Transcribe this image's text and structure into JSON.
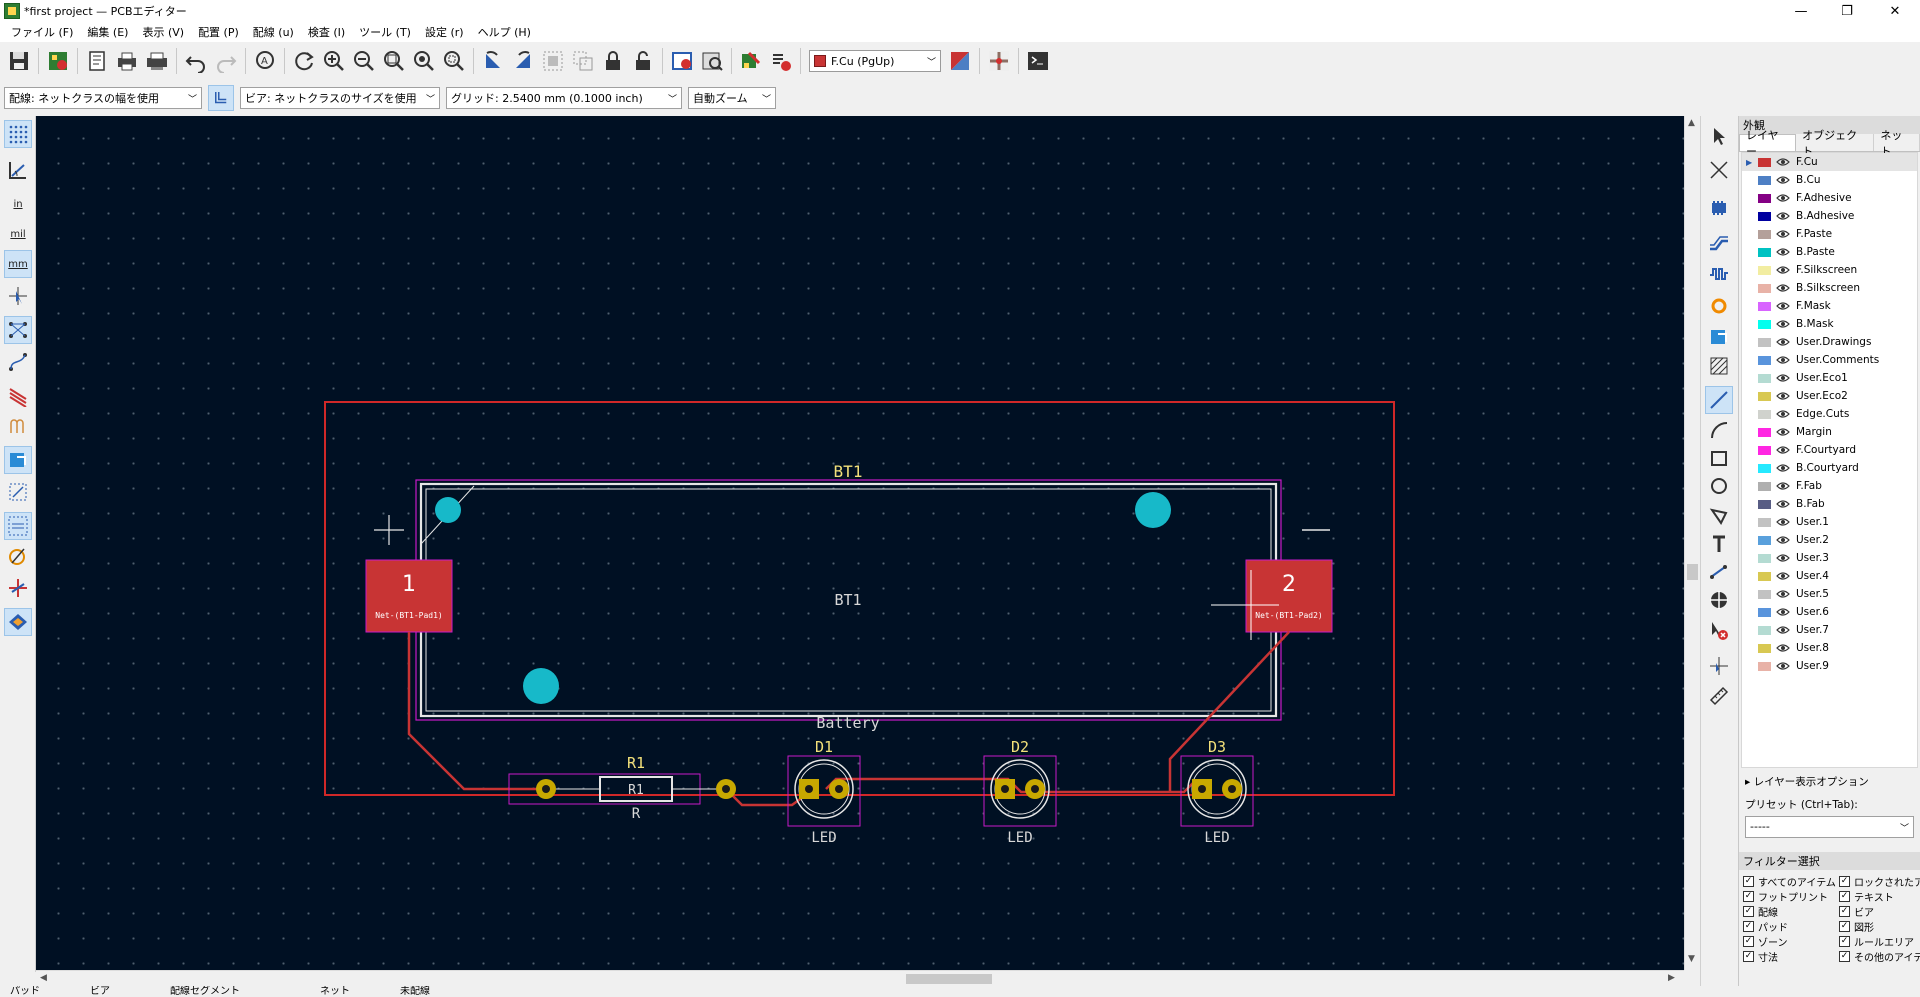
{
  "window": {
    "title": "*first project — PCBエディター",
    "controls": {
      "minimize": "—",
      "restore": "❐",
      "close": "✕"
    }
  },
  "menu": [
    "ファイル (F)",
    "編集 (E)",
    "表示 (V)",
    "配置 (P)",
    "配線 (u)",
    "検査 (I)",
    "ツール (T)",
    "設定 (r)",
    "ヘルプ (H)"
  ],
  "toolbar": {
    "layer_select": "F.Cu (PgUp)"
  },
  "toolbar2": {
    "track_width": "配線: ネットクラスの幅を使用",
    "via_size": "ビア: ネットクラスのサイズを使用",
    "grid": "グリッド: 2.5400 mm (0.1000 inch)",
    "zoom": "自動ズーム"
  },
  "lefttb": {
    "inch": "in",
    "mil": "mil",
    "mm": "mm"
  },
  "board": {
    "bt1_ref_top": "BT1",
    "bt1_ref_center": "BT1",
    "bt1_value": "Battery",
    "pad1_num": "1",
    "pad1_net": "Net-(BT1-Pad1)",
    "pad2_num": "2",
    "pad2_net": "Net-(BT1-Pad2)",
    "r1_ref": "R1",
    "r1_body": "R1",
    "r1_value": "R",
    "d1_ref": "D1",
    "d1_value": "LED",
    "d2_ref": "D2",
    "d2_value": "LED",
    "d3_ref": "D3",
    "d3_value": "LED",
    "colors": {
      "background": "#001023",
      "edge_cuts": "#d02828",
      "courtyard": "#c81ac8",
      "copper_front": "#c83434",
      "silkscreen": "#e6e6e6",
      "ref_text": "#f2e07a",
      "npth": "#17b9c9",
      "pad_gold": "#c8a800"
    }
  },
  "appearance": {
    "header": "外観",
    "tabs": [
      "レイヤー",
      "オブジェクト",
      "ネット"
    ],
    "layers": [
      {
        "name": "F.Cu",
        "color": "#c83434"
      },
      {
        "name": "B.Cu",
        "color": "#4d7fc4"
      },
      {
        "name": "F.Adhesive",
        "color": "#840084"
      },
      {
        "name": "B.Adhesive",
        "color": "#0000a0"
      },
      {
        "name": "F.Paste",
        "color": "#b4a09a"
      },
      {
        "name": "B.Paste",
        "color": "#00c2c2"
      },
      {
        "name": "F.Silkscreen",
        "color": "#f2eda1"
      },
      {
        "name": "B.Silkscreen",
        "color": "#e8b2a7"
      },
      {
        "name": "F.Mask",
        "color": "#d864ff"
      },
      {
        "name": "B.Mask",
        "color": "#02ffee"
      },
      {
        "name": "User.Drawings",
        "color": "#c2c2c2"
      },
      {
        "name": "User.Comments",
        "color": "#5994dc"
      },
      {
        "name": "User.Eco1",
        "color": "#b4dbd2"
      },
      {
        "name": "User.Eco2",
        "color": "#d8c852"
      },
      {
        "name": "Edge.Cuts",
        "color": "#d0d2cd"
      },
      {
        "name": "Margin",
        "color": "#ff26e2"
      },
      {
        "name": "F.Courtyard",
        "color": "#ff26e2"
      },
      {
        "name": "B.Courtyard",
        "color": "#26e9ff"
      },
      {
        "name": "F.Fab",
        "color": "#afafaf"
      },
      {
        "name": "B.Fab",
        "color": "#585d84"
      },
      {
        "name": "User.1",
        "color": "#c2c2c2"
      },
      {
        "name": "User.2",
        "color": "#59a0dc"
      },
      {
        "name": "User.3",
        "color": "#b4dbd2"
      },
      {
        "name": "User.4",
        "color": "#d8c852"
      },
      {
        "name": "User.5",
        "color": "#c2c2c2"
      },
      {
        "name": "User.6",
        "color": "#5994dc"
      },
      {
        "name": "User.7",
        "color": "#b4dbd2"
      },
      {
        "name": "User.8",
        "color": "#d8c852"
      },
      {
        "name": "User.9",
        "color": "#e8b2a7"
      }
    ],
    "layer_display_options": "レイヤー表示オプション",
    "preset_label": "プリセット (Ctrl+Tab):",
    "preset_value": "-----",
    "filter_header": "フィルター選択",
    "filters": [
      "すべてのアイテム",
      "ロックされたアイ",
      "フットプリント",
      "テキスト",
      "配線",
      "ビア",
      "パッド",
      "図形",
      "ゾーン",
      "ルールエリア",
      "寸法",
      "その他のアイテ"
    ]
  },
  "statusbar": [
    "パッド",
    "ビア",
    "配線セグメント",
    "ネット",
    "未配線"
  ]
}
